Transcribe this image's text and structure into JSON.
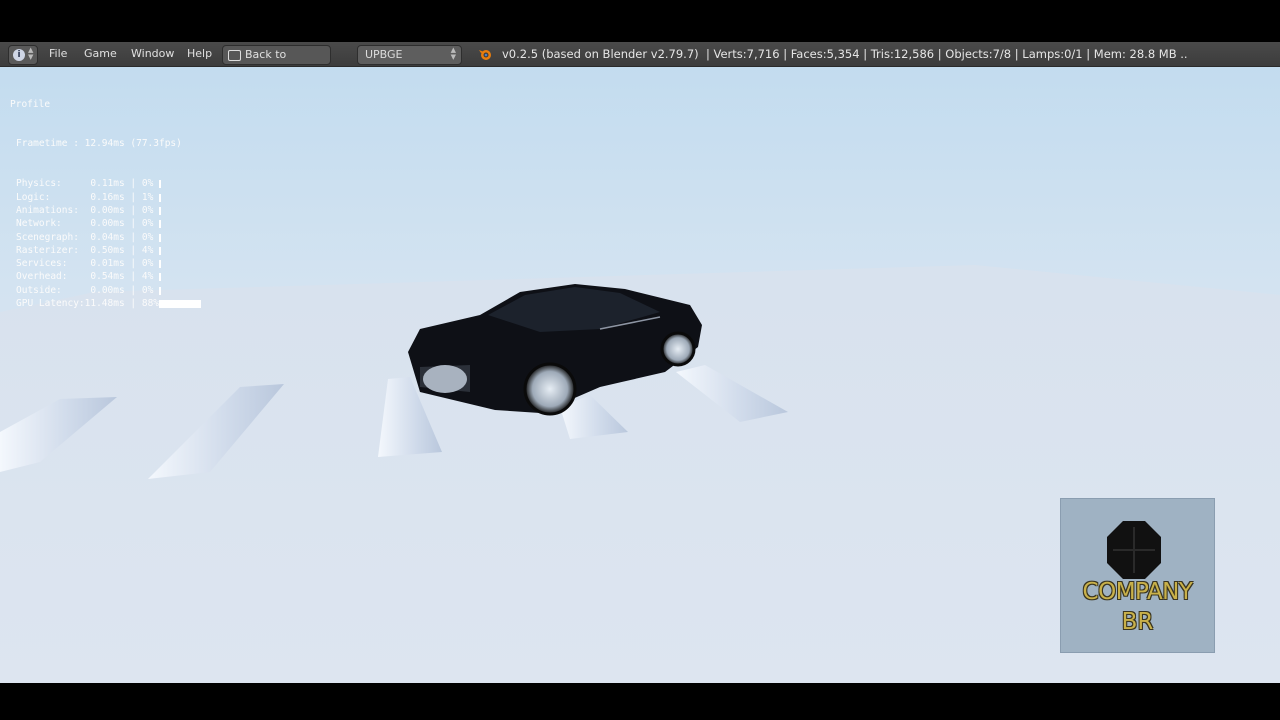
{
  "menubar": {
    "info_icon": "info-icon",
    "menus": [
      "File",
      "Game",
      "Window",
      "Help"
    ],
    "back_button": "Back to Previous",
    "engine": "UPBGE",
    "version": "v0.2.5 (based on Blender v2.79.7)",
    "stats": "| Verts:7,716 | Faces:5,354 | Tris:12,586 | Objects:7/8 | Lamps:0/1 | Mem: 28.8 MB .."
  },
  "profile": {
    "title": "Profile",
    "frametime": "Frametime : 12.94ms (77.3fps)",
    "rows": [
      {
        "label": "Physics:",
        "time": "0.11ms",
        "percent": "0%",
        "fraction": 0.0
      },
      {
        "label": "Logic:",
        "time": "0.16ms",
        "percent": "1%",
        "fraction": 0.01
      },
      {
        "label": "Animations:",
        "time": "0.00ms",
        "percent": "0%",
        "fraction": 0.0
      },
      {
        "label": "Network:",
        "time": "0.00ms",
        "percent": "0%",
        "fraction": 0.0
      },
      {
        "label": "Scenegraph:",
        "time": "0.04ms",
        "percent": "0%",
        "fraction": 0.0
      },
      {
        "label": "Rasterizer:",
        "time": "0.50ms",
        "percent": "4%",
        "fraction": 0.04
      },
      {
        "label": "Services:",
        "time": "0.01ms",
        "percent": "0%",
        "fraction": 0.0
      },
      {
        "label": "Overhead:",
        "time": "0.54ms",
        "percent": "4%",
        "fraction": 0.04
      },
      {
        "label": "Outside:",
        "time": "0.00ms",
        "percent": "0%",
        "fraction": 0.0
      },
      {
        "label": "GPU Latency:",
        "time": "11.48ms",
        "percent": "88%",
        "fraction": 0.88
      }
    ]
  },
  "logo": {
    "line1": "COMPANY",
    "line2": "BR"
  },
  "colors": {
    "sky": "#c3dcef",
    "ground": "#dfe7f1",
    "logo_text": "#c9b14a"
  }
}
